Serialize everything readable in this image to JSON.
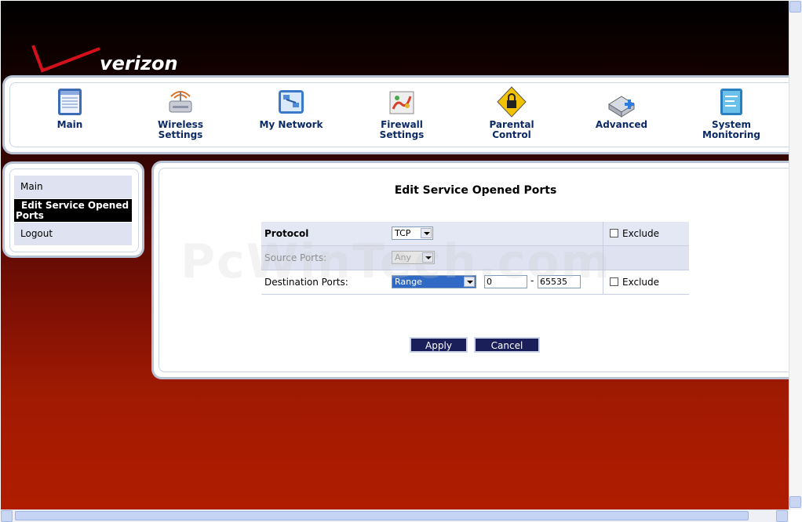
{
  "brand": {
    "logo_text": "verizon"
  },
  "nav": {
    "items": [
      {
        "label": "Main",
        "icon": "main-icon"
      },
      {
        "label": "Wireless\nSettings",
        "icon": "wireless-icon"
      },
      {
        "label": "My Network",
        "icon": "network-icon"
      },
      {
        "label": "Firewall\nSettings",
        "icon": "firewall-icon"
      },
      {
        "label": "Parental\nControl",
        "icon": "parental-lock-icon"
      },
      {
        "label": "Advanced",
        "icon": "advanced-icon"
      },
      {
        "label": "System\nMonitoring",
        "icon": "monitor-icon"
      }
    ]
  },
  "sidebar": {
    "items": [
      {
        "label": "Main"
      },
      {
        "label": "Edit Service Opened Ports",
        "active": true
      },
      {
        "label": "Logout"
      }
    ]
  },
  "main": {
    "title": "Edit Service Opened Ports",
    "rows": {
      "protocol": {
        "label": "Protocol",
        "select": "TCP",
        "exclude": "Exclude"
      },
      "source": {
        "label": "Source Ports:",
        "select": "Any"
      },
      "destination": {
        "label": "Destination Ports:",
        "select": "Range",
        "from": "0",
        "dash": "-",
        "to": "65535",
        "exclude": "Exclude"
      }
    },
    "buttons": {
      "apply": "Apply",
      "cancel": "Cancel"
    }
  },
  "watermark": "PcWinTech.com",
  "colors": {
    "accent": "#1a1f59",
    "nav_text": "#0b2a66",
    "frame": "#b9c3d6",
    "row_bg": "#dfe3f1"
  }
}
